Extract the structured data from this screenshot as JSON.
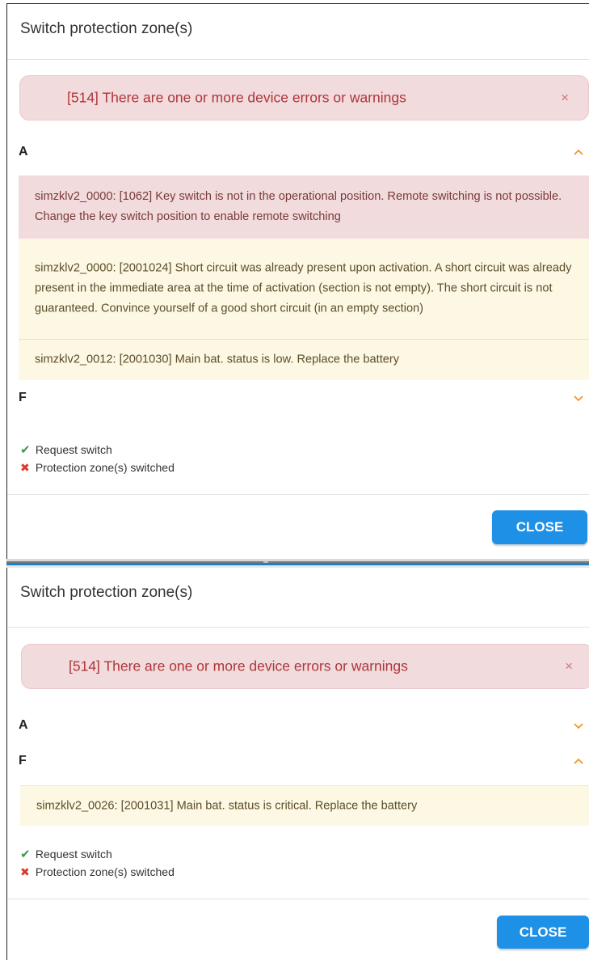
{
  "colors": {
    "error_bg": "#f1dbdc",
    "error_text": "#b0353a",
    "warning_bg": "#fcf8e3",
    "chevron": "#f0962a",
    "button": "#1e90e6",
    "check": "#3c9b4a",
    "cross": "#d9392f"
  },
  "dialog1": {
    "title": "Switch protection zone(s)",
    "alert": {
      "text": "[514] There are one or more device errors or warnings",
      "close": "×"
    },
    "sections": [
      {
        "label": "A",
        "expanded": true,
        "messages": [
          {
            "type": "error",
            "text": "simzklv2_0000: [1062] Key switch is not in the operational position. Remote switching is not possible. Change the key switch position to enable remote switching"
          },
          {
            "type": "warning",
            "text": "simzklv2_0000: [2001024] Short circuit was already present upon activation. A short circuit was already present in the immediate area at the time of activation (section is not empty). The short circuit is not guaranteed. Convince yourself of a good short circuit (in an empty section)"
          },
          {
            "type": "warning",
            "text": "simzklv2_0012: [2001030] Main bat. status is low. Replace the battery"
          }
        ]
      },
      {
        "label": "F",
        "expanded": false,
        "messages": []
      }
    ],
    "status": [
      {
        "icon": "check-icon",
        "glyph": "✔",
        "text": "Request switch"
      },
      {
        "icon": "cross-icon",
        "glyph": "✖",
        "text": "Protection zone(s) switched"
      }
    ],
    "close_label": "CLOSE"
  },
  "dialog2": {
    "title": "Switch protection zone(s)",
    "alert": {
      "text": "[514] There are one or more device errors or warnings",
      "close": "×"
    },
    "sections": [
      {
        "label": "A",
        "expanded": false,
        "messages": []
      },
      {
        "label": "F",
        "expanded": true,
        "messages": [
          {
            "type": "warning",
            "text": "simzklv2_0026: [2001031] Main bat. status is critical. Replace the battery"
          }
        ]
      }
    ],
    "status": [
      {
        "icon": "check-icon",
        "glyph": "✔",
        "text": "Request switch"
      },
      {
        "icon": "cross-icon",
        "glyph": "✖",
        "text": "Protection zone(s) switched"
      }
    ],
    "close_label": "CLOSE"
  }
}
